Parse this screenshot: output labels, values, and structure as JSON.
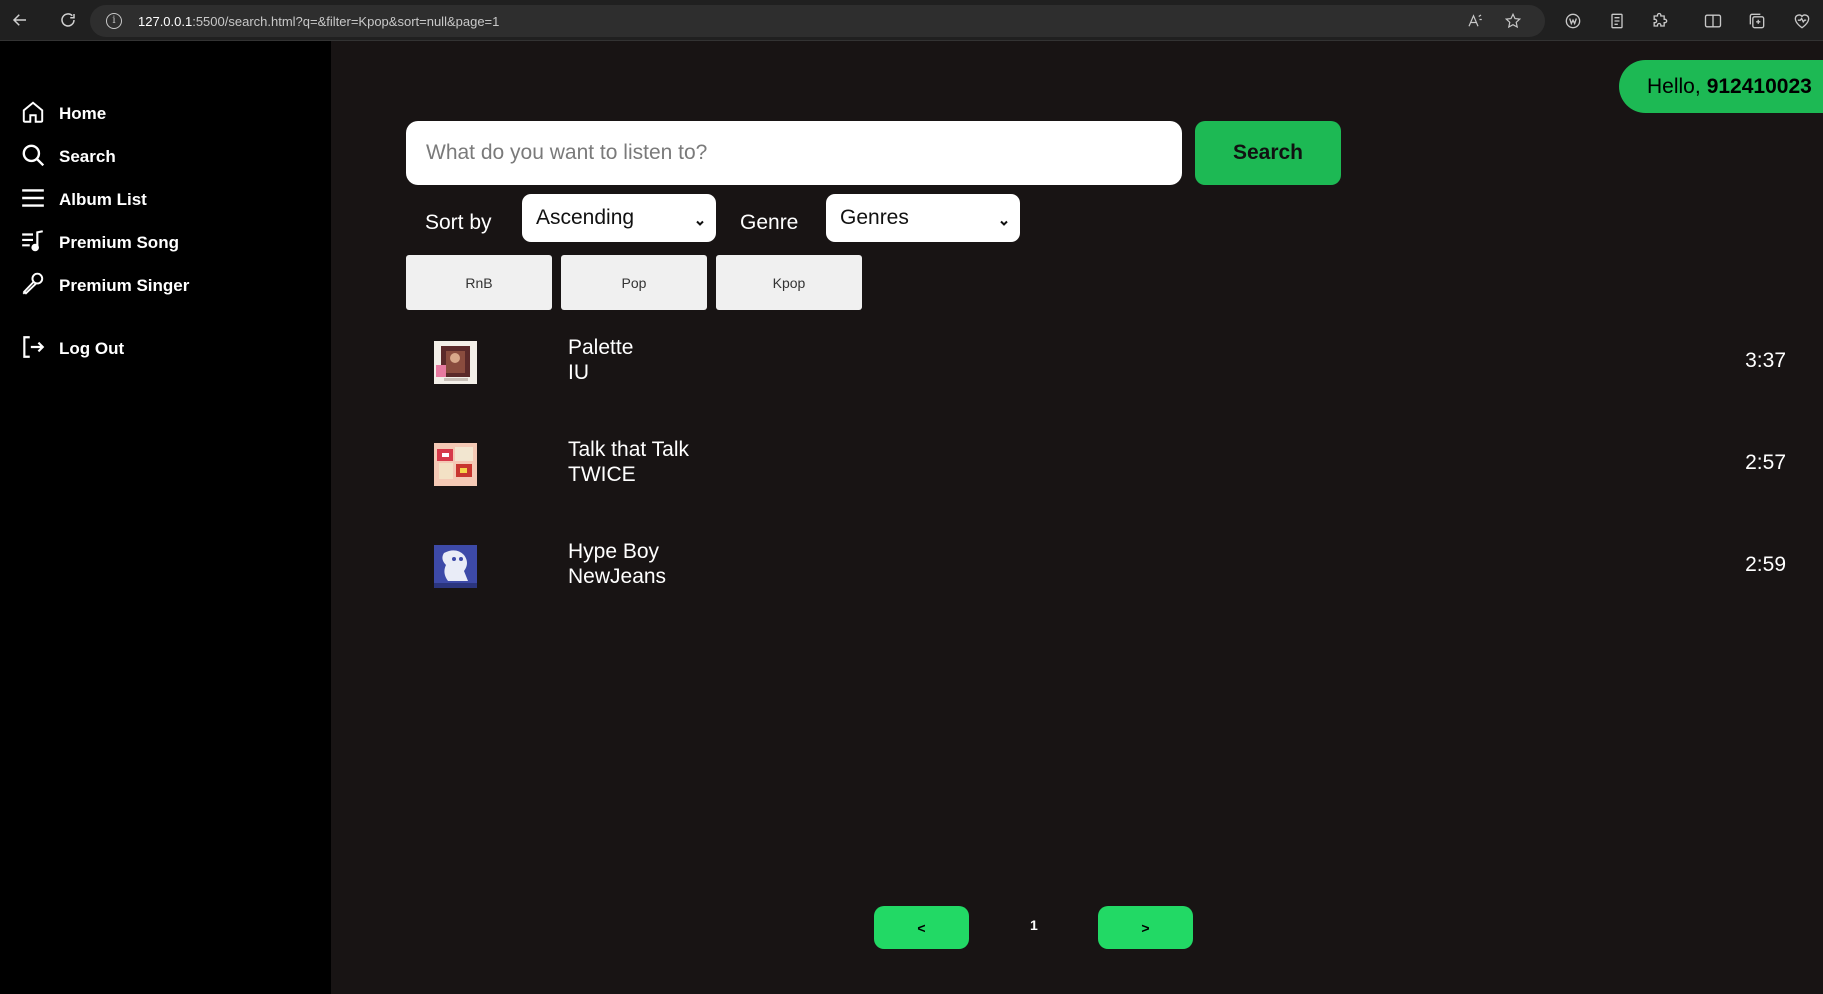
{
  "browser": {
    "url_host": "127.0.0.1",
    "url_rest": ":5500/search.html?q=&filter=Kpop&sort=null&page=1"
  },
  "sidebar": {
    "items": [
      {
        "label": "Home",
        "icon": "home-icon"
      },
      {
        "label": "Search",
        "icon": "search-icon"
      },
      {
        "label": "Album List",
        "icon": "list-icon"
      },
      {
        "label": "Premium Song",
        "icon": "music-list-icon"
      },
      {
        "label": "Premium Singer",
        "icon": "microphone-icon"
      },
      {
        "label": "Log Out",
        "icon": "logout-icon"
      }
    ]
  },
  "header": {
    "greeting": "Hello,",
    "username": "912410023"
  },
  "search": {
    "placeholder": "What do you want to listen to?",
    "value": "",
    "button_label": "Search"
  },
  "filters": {
    "sort_label": "Sort by",
    "sort_value": "Ascending",
    "genre_label": "Genre",
    "genre_value": "Genres"
  },
  "chips": [
    "RnB",
    "Pop",
    "Kpop"
  ],
  "songs": [
    {
      "title": "Palette",
      "artist": "IU",
      "duration": "3:37"
    },
    {
      "title": "Talk that Talk",
      "artist": "TWICE",
      "duration": "2:57"
    },
    {
      "title": "Hype Boy",
      "artist": "NewJeans",
      "duration": "2:59"
    }
  ],
  "pagination": {
    "prev_label": "<",
    "current_page": "1",
    "next_label": ">"
  },
  "colors": {
    "accent": "#1db954",
    "sidebar_bg": "#000000",
    "main_bg": "#181414"
  }
}
